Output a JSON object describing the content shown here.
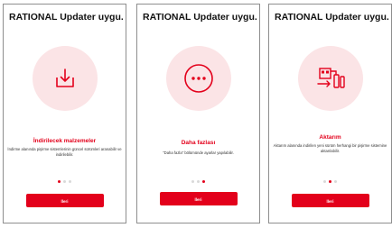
{
  "screens": [
    {
      "title": "RATIONAL Updater uygu...",
      "icon": "download-icon",
      "heading": "İndirilecek malzemeler",
      "description": "İndirme alanında pişirme sistemlerinin güncel sürümleri aranabilir ve indirilebilir.",
      "active_dot": 1,
      "button_label": "İleri"
    },
    {
      "title": "RATIONAL Updater uygu...",
      "icon": "more-icon",
      "heading": "Daha fazlası",
      "description": "\"Daha fazla\" bölümünde ayarlar yapılabilir.",
      "active_dot": 3,
      "button_label": "İleri"
    },
    {
      "title": "RATIONAL Updater uygu...",
      "icon": "transfer-usb-icon",
      "heading": "Aktarım",
      "description": "Aktarım alanında indirilen yeni sürüm herhangi bir pişirme sistemine aktarılabilir.",
      "active_dot": 2,
      "button_label": "İleri"
    }
  ],
  "colors": {
    "accent": "#e3001b",
    "icon_bg": "#fbe4e6",
    "dot_inactive": "#d9d9d9"
  }
}
